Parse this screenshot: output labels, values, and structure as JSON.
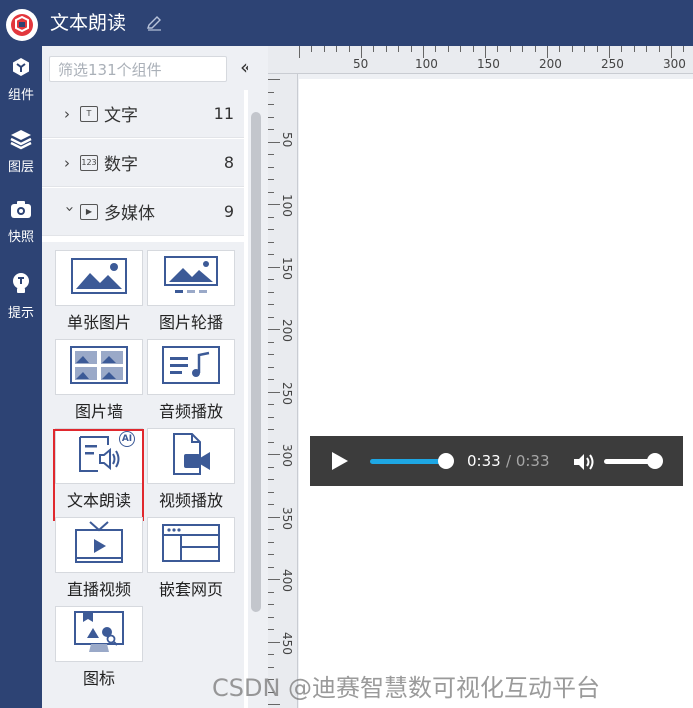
{
  "app": {
    "title": "文本朗读"
  },
  "rail": [
    {
      "label": "组件",
      "icon": "cube-icon"
    },
    {
      "label": "图层",
      "icon": "layers-icon"
    },
    {
      "label": "快照",
      "icon": "camera-icon"
    },
    {
      "label": "提示",
      "icon": "lightbulb-icon"
    }
  ],
  "panel": {
    "filter_placeholder": "筛选131个组件",
    "collapse_glyph": "«",
    "categories": [
      {
        "label": "文字",
        "count": "11",
        "icon_text": "T",
        "expanded": false
      },
      {
        "label": "数字",
        "count": "8",
        "icon_text": "123",
        "expanded": false
      },
      {
        "label": "多媒体",
        "count": "9",
        "icon_text": "▶",
        "expanded": true
      }
    ],
    "tiles": [
      {
        "label": "单张图片",
        "icon": "image-icon"
      },
      {
        "label": "图片轮播",
        "icon": "image-carousel-icon"
      },
      {
        "label": "图片墙",
        "icon": "image-wall-icon"
      },
      {
        "label": "音频播放",
        "icon": "audio-icon"
      },
      {
        "label": "文本朗读",
        "icon": "text-to-speech-icon",
        "badge": "AI"
      },
      {
        "label": "视频播放",
        "icon": "video-file-icon"
      },
      {
        "label": "直播视频",
        "icon": "live-tv-icon"
      },
      {
        "label": "嵌套网页",
        "icon": "webpage-icon"
      },
      {
        "label": "图标",
        "icon": "icon-library-icon"
      }
    ]
  },
  "ruler": {
    "top_labels": [
      "50",
      "100",
      "150",
      "200",
      "250",
      "300"
    ],
    "left_labels": [
      "50",
      "100",
      "150",
      "200",
      "250",
      "300",
      "350",
      "400",
      "450"
    ]
  },
  "player": {
    "current_time": "0:33",
    "duration": "/ 0:33",
    "progress": 1.0,
    "volume": 1.0
  },
  "watermark": "CSDN @迪赛智慧数可视化互动平台",
  "colors": {
    "header": "#2d4374",
    "accent": "#1ea7e4",
    "selection": "#e0282e",
    "player_bg": "#3c3c3c"
  }
}
